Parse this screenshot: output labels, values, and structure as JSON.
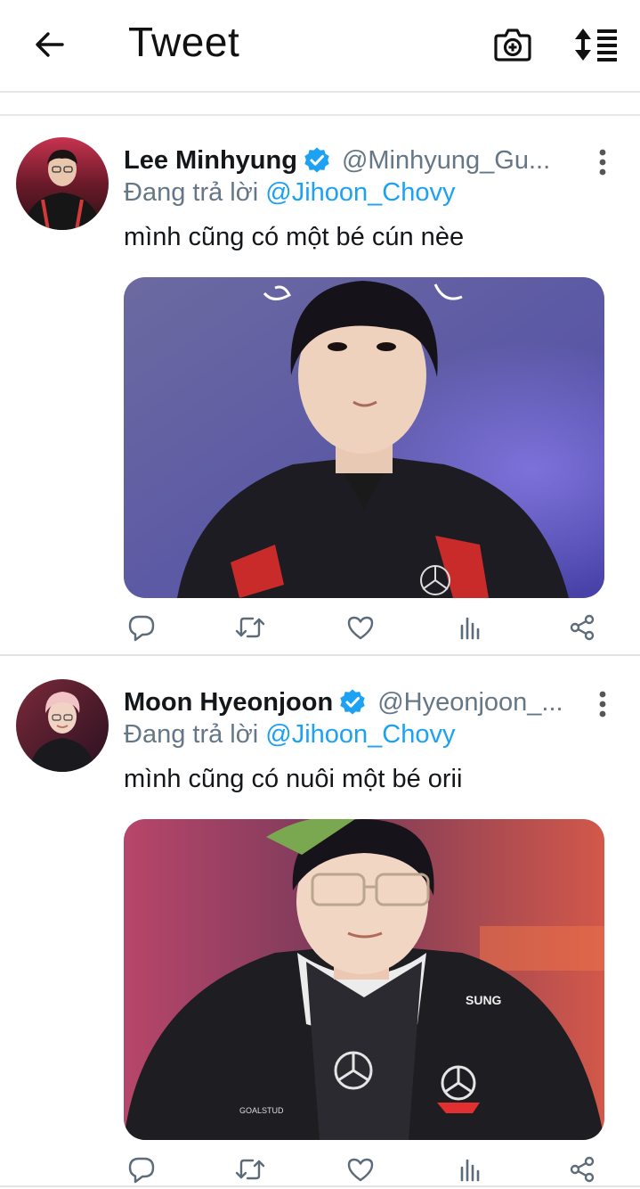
{
  "header": {
    "title": "Tweet",
    "back_icon": "arrow-left-icon",
    "camera_icon": "camera-plus-icon",
    "sort_icon": "sort-list-icon"
  },
  "colors": {
    "link": "#1da1f2",
    "secondary_text": "#657786",
    "verified": "#1da1f2"
  },
  "tweets": [
    {
      "display_name": "Lee Minhyung",
      "handle": "@Minhyung_Gu...",
      "verified": true,
      "reply_prefix": "Đang trả lời ",
      "reply_to": "@Jihoon_Chovy",
      "text": "mình cũng có một bé cún nèe",
      "media_description": "photo",
      "actions": [
        "reply-icon",
        "retweet-icon",
        "like-icon",
        "stats-icon",
        "share-icon"
      ]
    },
    {
      "display_name": "Moon Hyeonjoon",
      "handle": "@Hyeonjoon_...",
      "verified": true,
      "reply_prefix": "Đang trả lời ",
      "reply_to": "@Jihoon_Chovy",
      "text": "mình cũng có nuôi một bé orii",
      "media_description": "photo",
      "actions": [
        "reply-icon",
        "retweet-icon",
        "like-icon",
        "stats-icon",
        "share-icon"
      ]
    }
  ]
}
